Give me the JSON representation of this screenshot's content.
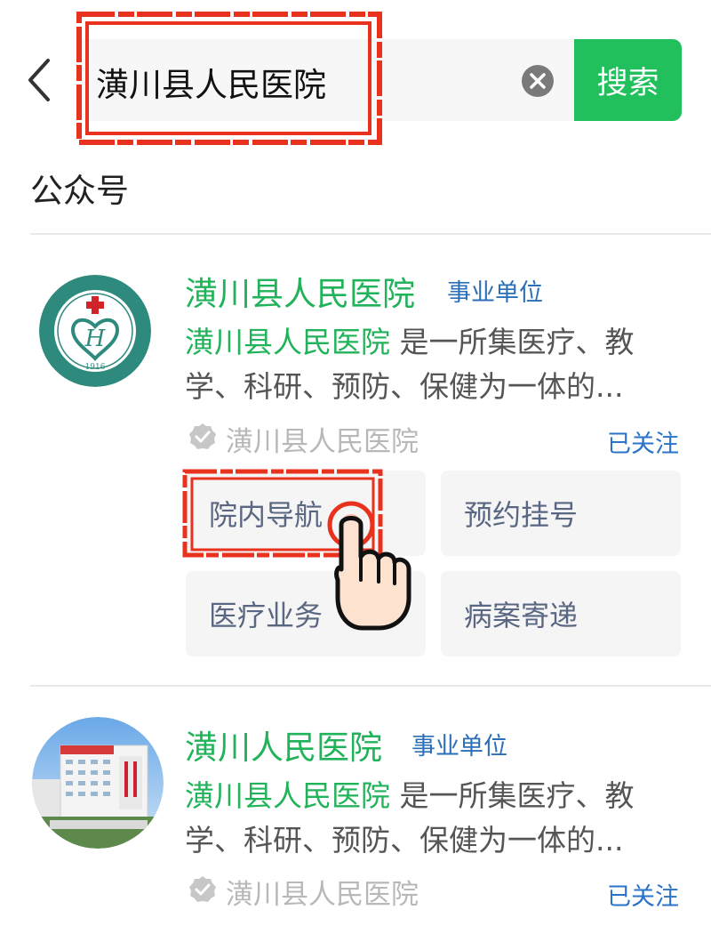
{
  "header": {
    "search_value": "潢川县人民医院",
    "search_button_label": "搜索"
  },
  "section_title": "公众号",
  "results": [
    {
      "name": "潢川县人民医院",
      "badge": "事业单位",
      "desc_highlight": "潢川县人民医院",
      "desc_text": " 是一所集医疗、教学、科研、预防、保健为一体的...",
      "verified_name": "潢川县人民医院",
      "follow_status": "已关注",
      "logo_year": "1916",
      "menu": [
        "院内导航",
        "预约挂号",
        "医疗业务",
        "病案寄递"
      ]
    },
    {
      "name": "潢川人民医院",
      "badge": "事业单位",
      "desc_highlight": "潢川县人民医院",
      "desc_text": " 是一所集医疗、教学、科研、预防、保健为一体的...",
      "verified_name": "潢川县人民医院",
      "follow_status": "已关注"
    }
  ],
  "colors": {
    "brand_green": "#21c05c",
    "name_green": "#21b35a",
    "badge_blue": "#2a6fb8",
    "annotation_red": "#e8321e"
  }
}
